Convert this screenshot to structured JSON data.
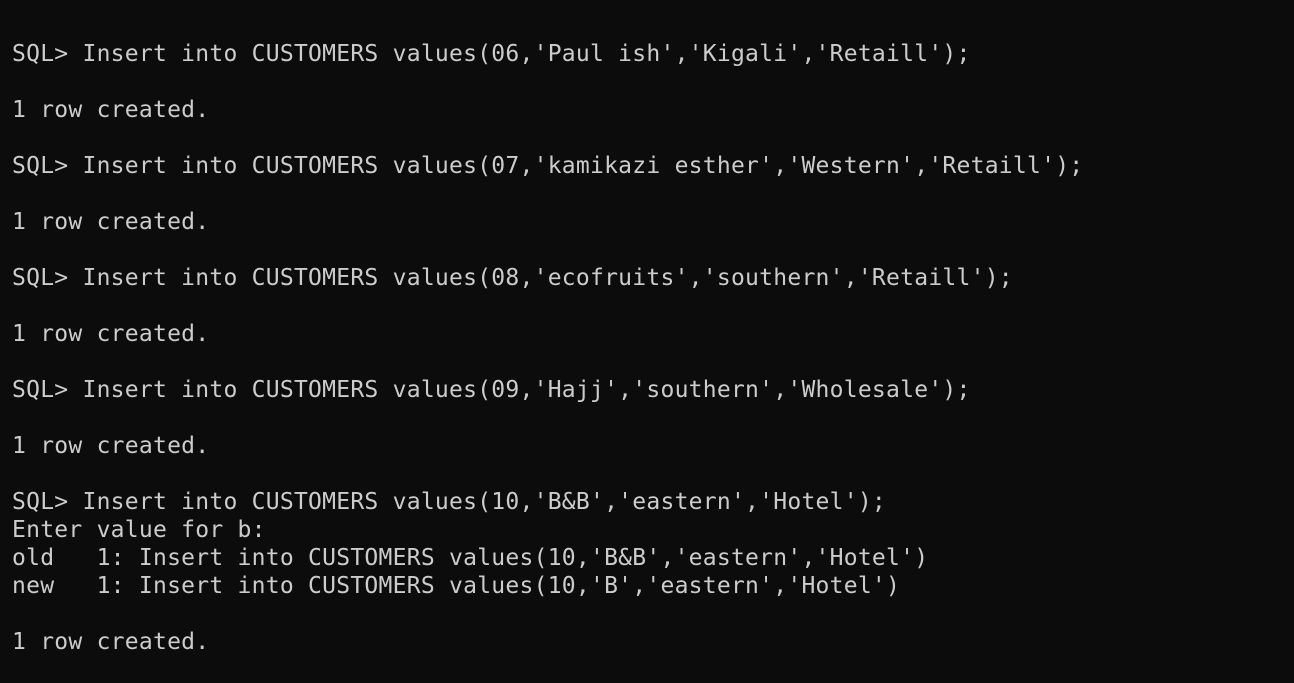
{
  "terminal": {
    "lines": [
      "SQL> Insert into CUSTOMERS values(06,'Paul ish','Kigali','Retaill');",
      "",
      "1 row created.",
      "",
      "SQL> Insert into CUSTOMERS values(07,'kamikazi esther','Western','Retaill');",
      "",
      "1 row created.",
      "",
      "SQL> Insert into CUSTOMERS values(08,'ecofruits','southern','Retaill');",
      "",
      "1 row created.",
      "",
      "SQL> Insert into CUSTOMERS values(09,'Hajj','southern','Wholesale');",
      "",
      "1 row created.",
      "",
      "SQL> Insert into CUSTOMERS values(10,'B&B','eastern','Hotel');",
      "Enter value for b:",
      "old   1: Insert into CUSTOMERS values(10,'B&B','eastern','Hotel')",
      "new   1: Insert into CUSTOMERS values(10,'B','eastern','Hotel')",
      "",
      "1 row created."
    ]
  }
}
